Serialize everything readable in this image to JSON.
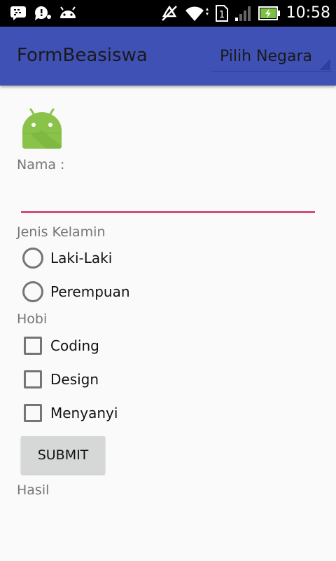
{
  "status_bar": {
    "time": "10:58",
    "left_icons": [
      "bbm-icon",
      "chat-icon",
      "android-icon"
    ],
    "right_icons": [
      "mute-icon",
      "wifi-icon",
      "sim-icon",
      "signal-icon",
      "battery-charging-icon"
    ],
    "sim_number": "1"
  },
  "toolbar": {
    "title": "FormBeasiswa",
    "spinner_value": "Pilih Negara",
    "color": "#3F51B5"
  },
  "form": {
    "nama_label": "Nama :",
    "nama_value": "",
    "jenis_kelamin_label": "Jenis Kelamin",
    "gender_options": [
      "Laki-Laki",
      "Perempuan"
    ],
    "hobi_label": "Hobi",
    "hobi_options": [
      "Coding",
      "Design",
      "Menyanyi"
    ],
    "submit_label": "SUBMIT",
    "hasil_label": "Hasil",
    "accent_color": "#D34E7F"
  }
}
